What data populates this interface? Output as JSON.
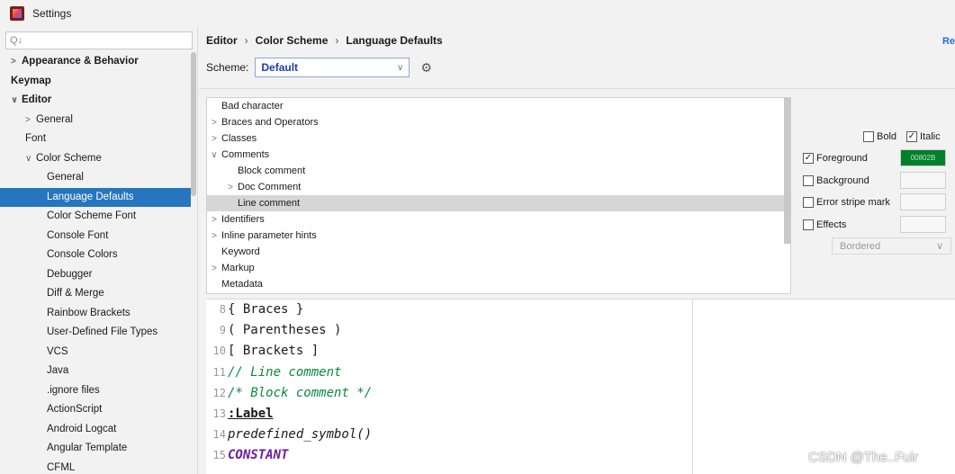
{
  "window": {
    "title": "Settings"
  },
  "search": {
    "placeholder": "Q↓"
  },
  "sidebar": {
    "items": [
      {
        "label": "Appearance & Behavior",
        "chev": ">",
        "indent": 0,
        "bold": true
      },
      {
        "label": "Keymap",
        "chev": "",
        "indent": 0,
        "bold": true
      },
      {
        "label": "Editor",
        "chev": "∨",
        "indent": 0,
        "bold": true
      },
      {
        "label": "General",
        "chev": ">",
        "indent": 1
      },
      {
        "label": "Font",
        "chev": "",
        "indent": 1
      },
      {
        "label": "Color Scheme",
        "chev": "∨",
        "indent": 1
      },
      {
        "label": "General",
        "chev": "",
        "indent": 2
      },
      {
        "label": "Language Defaults",
        "chev": "",
        "indent": 2,
        "selected": true
      },
      {
        "label": "Color Scheme Font",
        "chev": "",
        "indent": 2
      },
      {
        "label": "Console Font",
        "chev": "",
        "indent": 2
      },
      {
        "label": "Console Colors",
        "chev": "",
        "indent": 2
      },
      {
        "label": "Debugger",
        "chev": "",
        "indent": 2
      },
      {
        "label": "Diff & Merge",
        "chev": "",
        "indent": 2
      },
      {
        "label": "Rainbow Brackets",
        "chev": "",
        "indent": 2
      },
      {
        "label": "User-Defined File Types",
        "chev": "",
        "indent": 2
      },
      {
        "label": "VCS",
        "chev": "",
        "indent": 2
      },
      {
        "label": "Java",
        "chev": "",
        "indent": 2
      },
      {
        "label": ".ignore files",
        "chev": "",
        "indent": 2
      },
      {
        "label": "ActionScript",
        "chev": "",
        "indent": 2
      },
      {
        "label": "Android Logcat",
        "chev": "",
        "indent": 2
      },
      {
        "label": "Angular Template",
        "chev": "",
        "indent": 2
      },
      {
        "label": "CFML",
        "chev": "",
        "indent": 2
      }
    ]
  },
  "breadcrumb": {
    "part1": "Editor",
    "sep": "›",
    "part2": "Color Scheme",
    "part3": "Language Defaults"
  },
  "reset_label": "Re",
  "scheme": {
    "label": "Scheme:",
    "value": "Default",
    "arrow": "∨"
  },
  "elements": [
    {
      "label": "Bad character",
      "chev": "",
      "indent": 0
    },
    {
      "label": "Braces and Operators",
      "chev": ">",
      "indent": 0
    },
    {
      "label": "Classes",
      "chev": ">",
      "indent": 0
    },
    {
      "label": "Comments",
      "chev": "∨",
      "indent": 0
    },
    {
      "label": "Block comment",
      "chev": "",
      "indent": 1
    },
    {
      "label": "Doc Comment",
      "chev": ">",
      "indent": 1
    },
    {
      "label": "Line comment",
      "chev": "",
      "indent": 1,
      "selected": true
    },
    {
      "label": "Identifiers",
      "chev": ">",
      "indent": 0
    },
    {
      "label": "Inline parameter hints",
      "chev": ">",
      "indent": 0
    },
    {
      "label": "Keyword",
      "chev": "",
      "indent": 0
    },
    {
      "label": "Markup",
      "chev": ">",
      "indent": 0
    },
    {
      "label": "Metadata",
      "chev": "",
      "indent": 0
    }
  ],
  "props": {
    "bold_label": "Bold",
    "bold_checked": false,
    "italic_label": "Italic",
    "italic_checked": true,
    "foreground_label": "Foreground",
    "foreground_checked": true,
    "foreground_value": "00802B",
    "foreground_color": "#00802b",
    "background_label": "Background",
    "error_stripe_label": "Error stripe mark",
    "effects_label": "Effects",
    "effects_value": "Bordered",
    "check_mark": "✓"
  },
  "preview": {
    "lines": [
      {
        "num": "8",
        "text": "{ Braces }",
        "style": "plain"
      },
      {
        "num": "9",
        "text": "( Parentheses )",
        "style": "plain"
      },
      {
        "num": "10",
        "text": "[ Brackets ]",
        "style": "plain"
      },
      {
        "num": "11",
        "text": "// Line comment",
        "style": "comment"
      },
      {
        "num": "12",
        "text": "/* Block comment */",
        "style": "comment"
      },
      {
        "num": "13",
        "text": ":Label",
        "style": "label"
      },
      {
        "num": "14",
        "text": "predefined_symbol()",
        "style": "italic"
      },
      {
        "num": "15",
        "text": "CONSTANT",
        "style": "const"
      }
    ]
  },
  "watermark": "CSDN @The..Fuir",
  "icons": {
    "app": "intellij-icon",
    "gear": "gear-icon",
    "search": "search-icon"
  }
}
